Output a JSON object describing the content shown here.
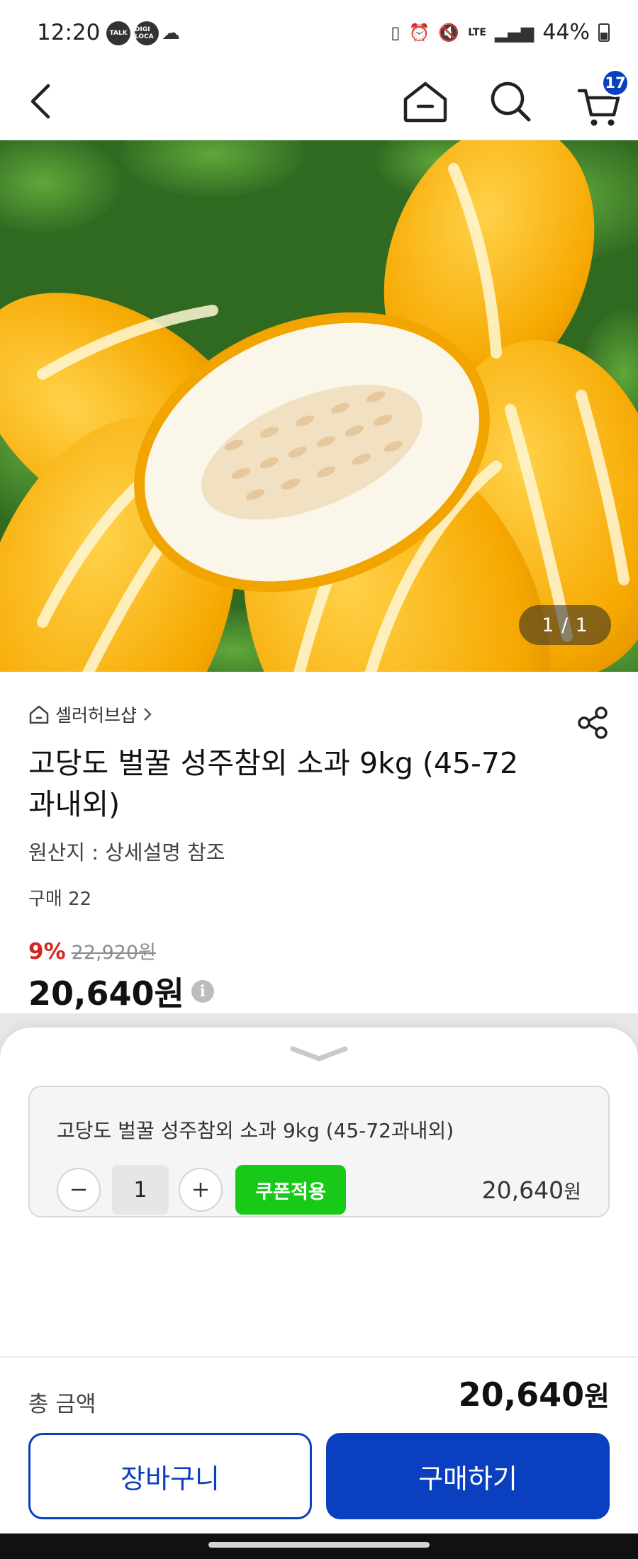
{
  "status_bar": {
    "time": "12:20",
    "apps": [
      "TALK",
      "DIGI LOCA"
    ],
    "network": "LTE",
    "battery": "44%"
  },
  "header": {
    "cart_count": "17"
  },
  "gallery": {
    "counter": "1 / 1"
  },
  "product": {
    "seller": "셀러허브샵",
    "title": "고당도 벌꿀 성주참외 소과 9kg (45-72과내외)",
    "origin": "원산지 : 상세설명 참조",
    "purchases": "구매 22",
    "discount": "9%",
    "original_price": "22,920원",
    "price": "20,640원"
  },
  "sheet": {
    "option_name": "고당도 벌꿀 성주참외 소과 9kg (45-72과내외)",
    "quantity": "1",
    "coupon_label": "쿠폰적용",
    "option_price": "20,640",
    "option_price_unit": "원",
    "total_label": "총 금액",
    "total_price": "20,640",
    "total_price_unit": "원",
    "cart_label": "장바구니",
    "buy_label": "구매하기"
  },
  "colors": {
    "brand_blue": "#0a3fbf",
    "coupon_green": "#18c918",
    "discount_red": "#d3261d"
  }
}
